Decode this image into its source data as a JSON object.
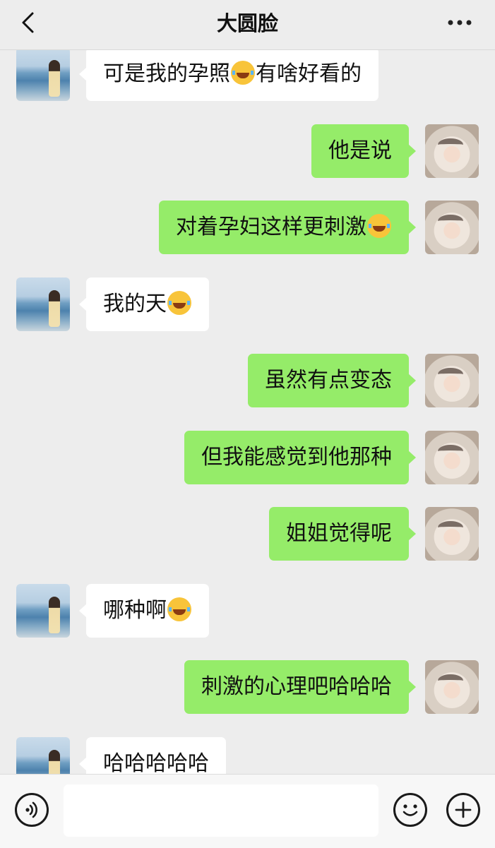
{
  "header": {
    "title": "大圆脸"
  },
  "icons": {
    "back": "chevron-left-icon",
    "more": "more-dots-icon",
    "voice": "voice-icon",
    "emoji": "emoji-face-icon",
    "plus": "plus-icon"
  },
  "colors": {
    "outgoing_bubble": "#95ec69",
    "incoming_bubble": "#ffffff",
    "background": "#ededed"
  },
  "messages": [
    {
      "side": "in",
      "parts": [
        "可是我的孕照",
        "有啥好看的"
      ],
      "emoji": "crying-laughing"
    },
    {
      "side": "out",
      "parts": [
        "他是说"
      ]
    },
    {
      "side": "out",
      "parts": [
        "对着孕妇这样更刺激",
        ""
      ],
      "emoji": "laughing-tears"
    },
    {
      "side": "in",
      "parts": [
        "我的天",
        ""
      ],
      "emoji": "crying-laughing"
    },
    {
      "side": "out",
      "parts": [
        "虽然有点变态"
      ]
    },
    {
      "side": "out",
      "parts": [
        "但我能感觉到他那种"
      ]
    },
    {
      "side": "out",
      "parts": [
        "姐姐觉得呢"
      ]
    },
    {
      "side": "in",
      "parts": [
        "哪种啊",
        ""
      ],
      "emoji": "laughing-tears"
    },
    {
      "side": "out",
      "parts": [
        "刺激的心理吧哈哈哈"
      ]
    },
    {
      "side": "in",
      "parts": [
        "哈哈哈哈哈"
      ]
    }
  ]
}
